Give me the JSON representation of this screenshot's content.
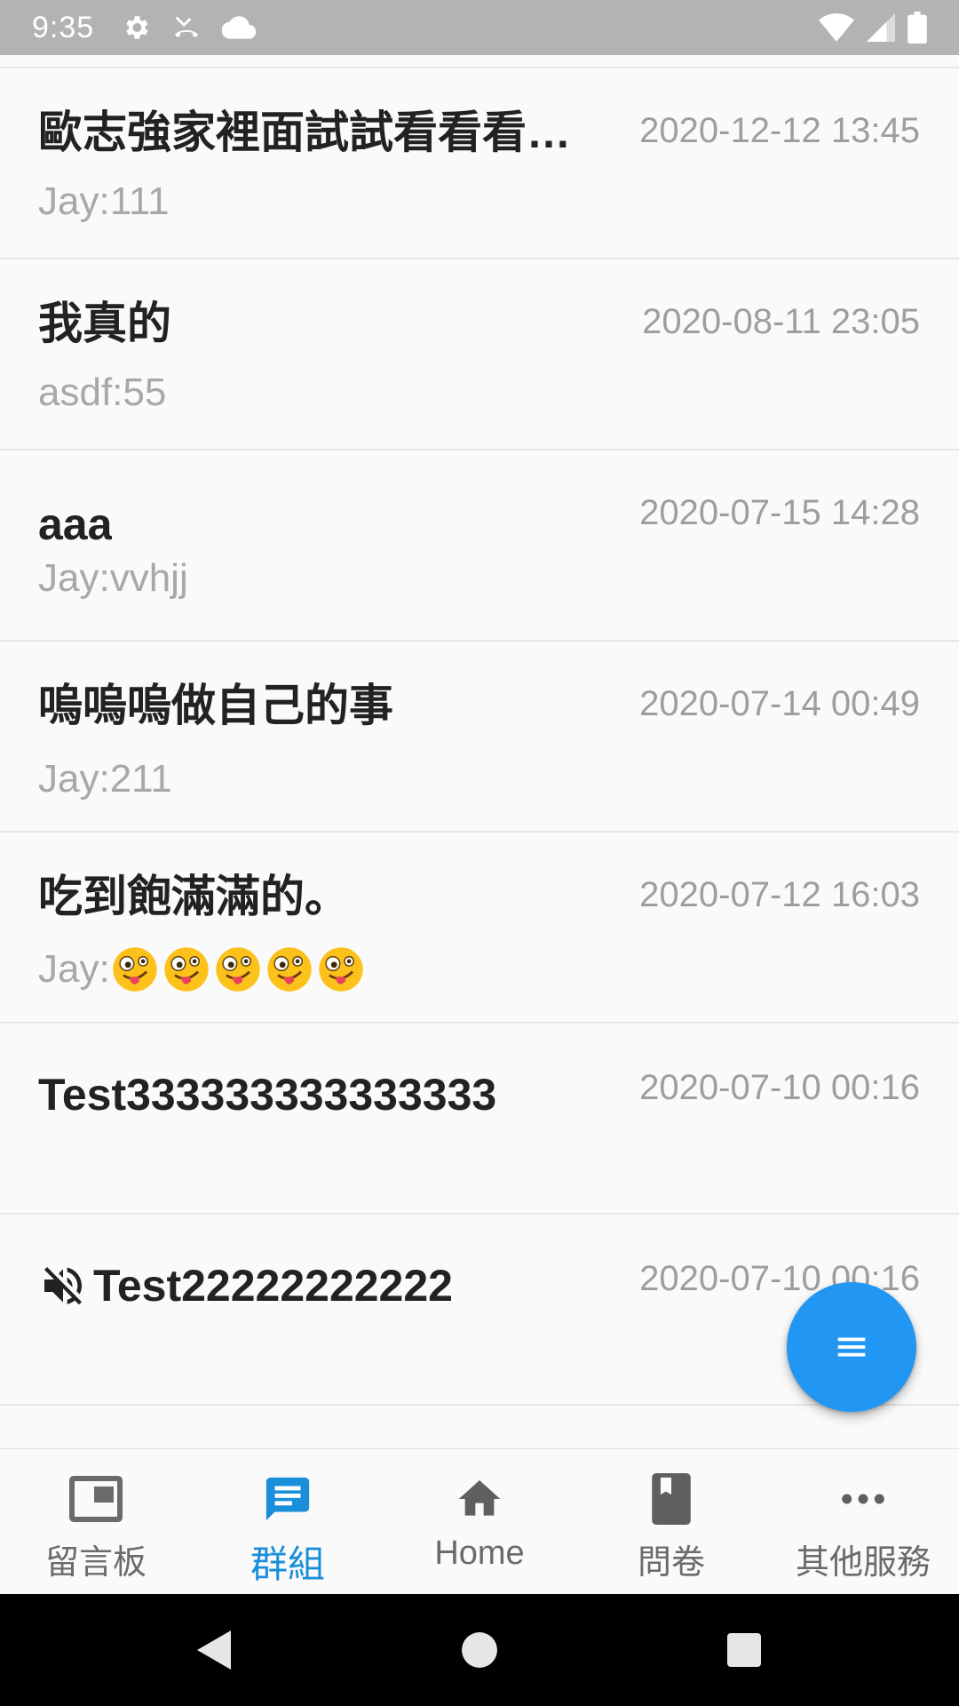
{
  "status_bar": {
    "time": "9:35",
    "left_icons": [
      "settings-icon",
      "missed-call-icon",
      "cloud-icon"
    ],
    "right_icons": [
      "wifi-icon",
      "signal-icon",
      "battery-icon"
    ]
  },
  "chats": [
    {
      "title": "歐志強家裡面試試看看看看看",
      "time": "2020-12-12 13:45",
      "preview": "Jay:111",
      "muted": false
    },
    {
      "title": "我真的",
      "time": "2020-08-11 23:05",
      "preview": "asdf:55",
      "muted": false
    },
    {
      "title": "aaa",
      "time": "2020-07-15 14:28",
      "preview": "Jay:vvhjj",
      "muted": false
    },
    {
      "title": "嗚嗚嗚做自己的事",
      "time": "2020-07-14 00:49",
      "preview": "Jay:211",
      "muted": false
    },
    {
      "title": "吃到飽滿滿的。",
      "time": "2020-07-12 16:03",
      "preview": "Jay:",
      "preview_emoji": "zany-face-emoji",
      "preview_emoji_count": 5,
      "muted": false
    },
    {
      "title": "Test333333333333333",
      "time": "2020-07-10 00:16",
      "preview": "",
      "muted": false
    },
    {
      "title": "Test22222222222",
      "time": "2020-07-10 00:16",
      "preview": "",
      "muted": true
    }
  ],
  "fab": {
    "icon": "menu-lines-icon"
  },
  "bottom_nav": {
    "items": [
      {
        "label": "留言板",
        "icon": "board-icon",
        "active": false
      },
      {
        "label": "群組",
        "icon": "chat-bubble-icon",
        "active": true
      },
      {
        "label": "Home",
        "icon": "home-icon",
        "active": false
      },
      {
        "label": "問卷",
        "icon": "book-icon",
        "active": false
      },
      {
        "label": "其他服務",
        "icon": "more-icon",
        "active": false
      }
    ]
  },
  "colors": {
    "accent": "#2196f3",
    "active_tab": "#1a8fd9",
    "status_bar": "#b3b3b3",
    "system_nav": "#000000"
  }
}
